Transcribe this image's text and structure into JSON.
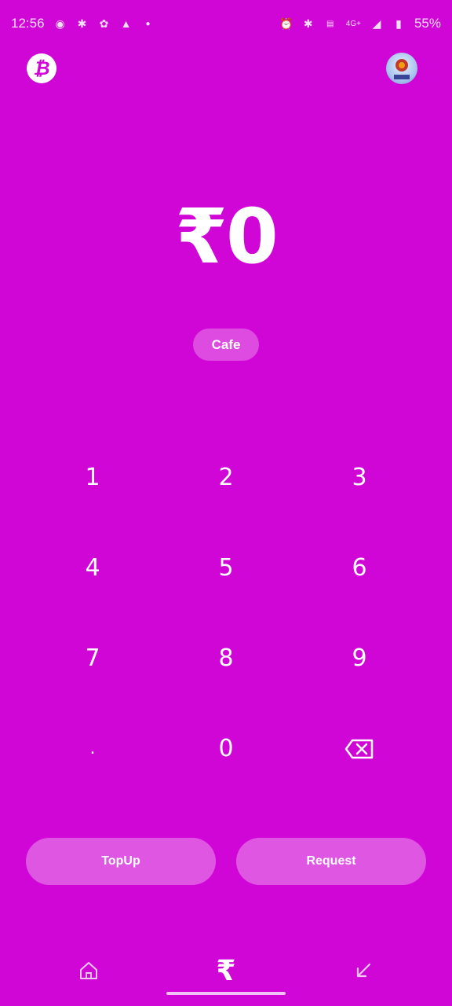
{
  "status_bar": {
    "time": "12:56",
    "battery": "55%",
    "network": "4G+"
  },
  "header": {
    "bitcoin_icon": "bitcoin-icon",
    "avatar_text": "SHL"
  },
  "amount": {
    "currency_symbol": "₹",
    "value": "0",
    "display": "₹0"
  },
  "tag_chip": {
    "label": "Cafe"
  },
  "keypad": {
    "keys": [
      "1",
      "2",
      "3",
      "4",
      "5",
      "6",
      "7",
      "8",
      "9",
      ".",
      "0",
      "backspace"
    ]
  },
  "actions": {
    "topup_label": "TopUp",
    "request_label": "Request"
  },
  "bottom_nav": {
    "items": [
      "home-icon",
      "rupee-icon",
      "arrow-down-left-icon"
    ]
  },
  "colors": {
    "background": "#d006d6",
    "text": "#ffffff"
  }
}
